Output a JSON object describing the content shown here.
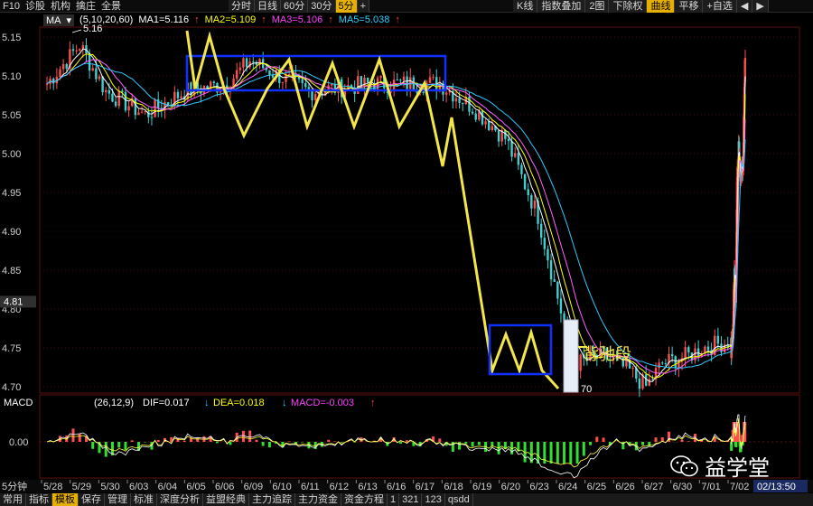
{
  "toolbar": {
    "left": [
      "F10",
      "诊股",
      "机构",
      "擒庄",
      "全景"
    ],
    "periods": [
      {
        "label": "分时",
        "active": false
      },
      {
        "label": "日线",
        "active": false
      },
      {
        "label": "60分",
        "active": false
      },
      {
        "label": "30分",
        "active": false
      },
      {
        "label": "5分",
        "active": true
      },
      {
        "label": "+",
        "active": false
      }
    ],
    "right": [
      {
        "label": "K线",
        "active": false
      },
      {
        "label": "指数叠加",
        "active": false
      },
      {
        "label": "2图",
        "active": false
      },
      {
        "label": "下除权",
        "active": false
      },
      {
        "label": "曲线",
        "active": true
      },
      {
        "label": "平移",
        "active": false
      },
      {
        "label": "+自选",
        "active": false
      },
      {
        "label": "◀",
        "active": false
      },
      {
        "label": "▶",
        "active": false
      }
    ]
  },
  "ma_info": {
    "selector": "MA",
    "params": "(5,10,20,60)",
    "ma1": "MA1=5.116",
    "ma2": "MA2=5.109",
    "ma3": "MA3=5.106",
    "ma5": "MA5=5.038",
    "colors": {
      "ma1": "#ffffff",
      "ma2": "#ffff00",
      "ma3": "#ff40ff",
      "ma5": "#30d0ff"
    }
  },
  "price_axis": {
    "ticks": [
      "5.15",
      "5.10",
      "5.05",
      "5.00",
      "4.95",
      "4.90",
      "4.85",
      "4.80",
      "4.75",
      "4.70"
    ],
    "current": "4.81",
    "high_label": "5.16",
    "low_label": "70"
  },
  "macd_info": {
    "label": "MACD",
    "params": "(26,12,9)",
    "dif": "DIF=0.017",
    "dea": "DEA=0.018",
    "macd": "MACD=-0.003",
    "zero": "0.00"
  },
  "x_axis": {
    "prefix": "5分钟",
    "dates": [
      "5/28",
      "5/29",
      "5/30",
      "6/03",
      "6/04",
      "6/05",
      "6/06",
      "6/09",
      "6/10",
      "6/11",
      "6/12",
      "6/13",
      "6/16",
      "6/17",
      "6/18",
      "6/19",
      "6/20",
      "6/23",
      "6/24",
      "6/25",
      "6/26",
      "6/27",
      "6/30",
      "7/01",
      "7/02"
    ],
    "time": "02/13:50"
  },
  "annotation": {
    "text": "背驰段"
  },
  "bottom_tabs": [
    {
      "label": "常用",
      "active": false
    },
    {
      "label": "指标",
      "active": false
    },
    {
      "label": "模板",
      "active": true
    },
    {
      "label": "保存",
      "active": false
    },
    {
      "label": "管理",
      "active": false
    },
    {
      "label": "标准",
      "active": false
    },
    {
      "label": "深度分析",
      "active": false
    },
    {
      "label": "益盟经典",
      "active": false
    },
    {
      "label": "主力追踪",
      "active": false
    },
    {
      "label": "主力资金",
      "active": false
    },
    {
      "label": "资金方程",
      "active": false
    },
    {
      "label": "1",
      "active": false
    },
    {
      "label": "321",
      "active": false
    },
    {
      "label": "123",
      "active": false
    },
    {
      "label": "qsdd",
      "active": false
    }
  ],
  "watermark": {
    "text": "益学堂"
  },
  "colors": {
    "up": "#ff5050",
    "down": "#40d0d0",
    "ma1": "#ffffff",
    "ma2": "#ffff00",
    "ma3": "#ff60ff",
    "ma5": "#30c8ff",
    "annotation_line": "#f2e64a",
    "annotation_box": "#1030ff",
    "macd_pos": "#ff5050",
    "macd_neg": "#30e030"
  }
}
